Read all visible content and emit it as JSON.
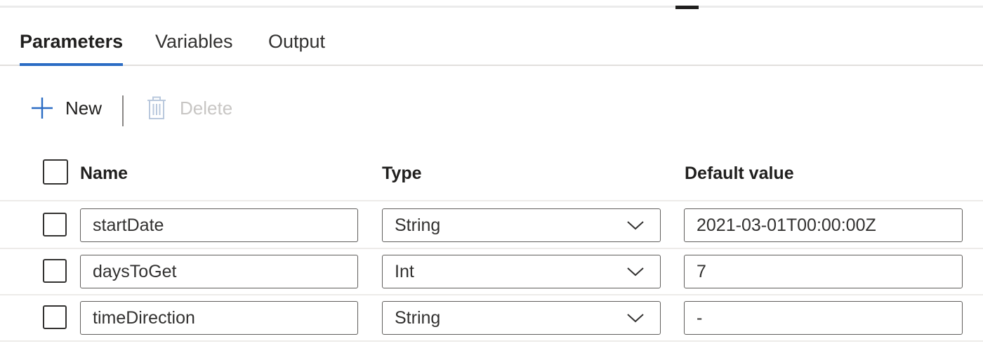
{
  "tabs": [
    {
      "label": "Parameters",
      "active": true
    },
    {
      "label": "Variables",
      "active": false
    },
    {
      "label": "Output",
      "active": false
    }
  ],
  "toolbar": {
    "new_label": "New",
    "delete_label": "Delete",
    "new_icon": "plus-icon",
    "delete_icon": "trash-icon"
  },
  "table": {
    "columns": [
      "Name",
      "Type",
      "Default value"
    ],
    "rows": [
      {
        "name": "startDate",
        "type": "String",
        "default": "2021-03-01T00:00:00Z"
      },
      {
        "name": "daysToGet",
        "type": "Int",
        "default": "7"
      },
      {
        "name": "timeDirection",
        "type": "String",
        "default": "-"
      }
    ]
  },
  "colors": {
    "accent": "#2b6cc4",
    "disabled_text": "#c8c6c4",
    "border": "#605e5c"
  }
}
